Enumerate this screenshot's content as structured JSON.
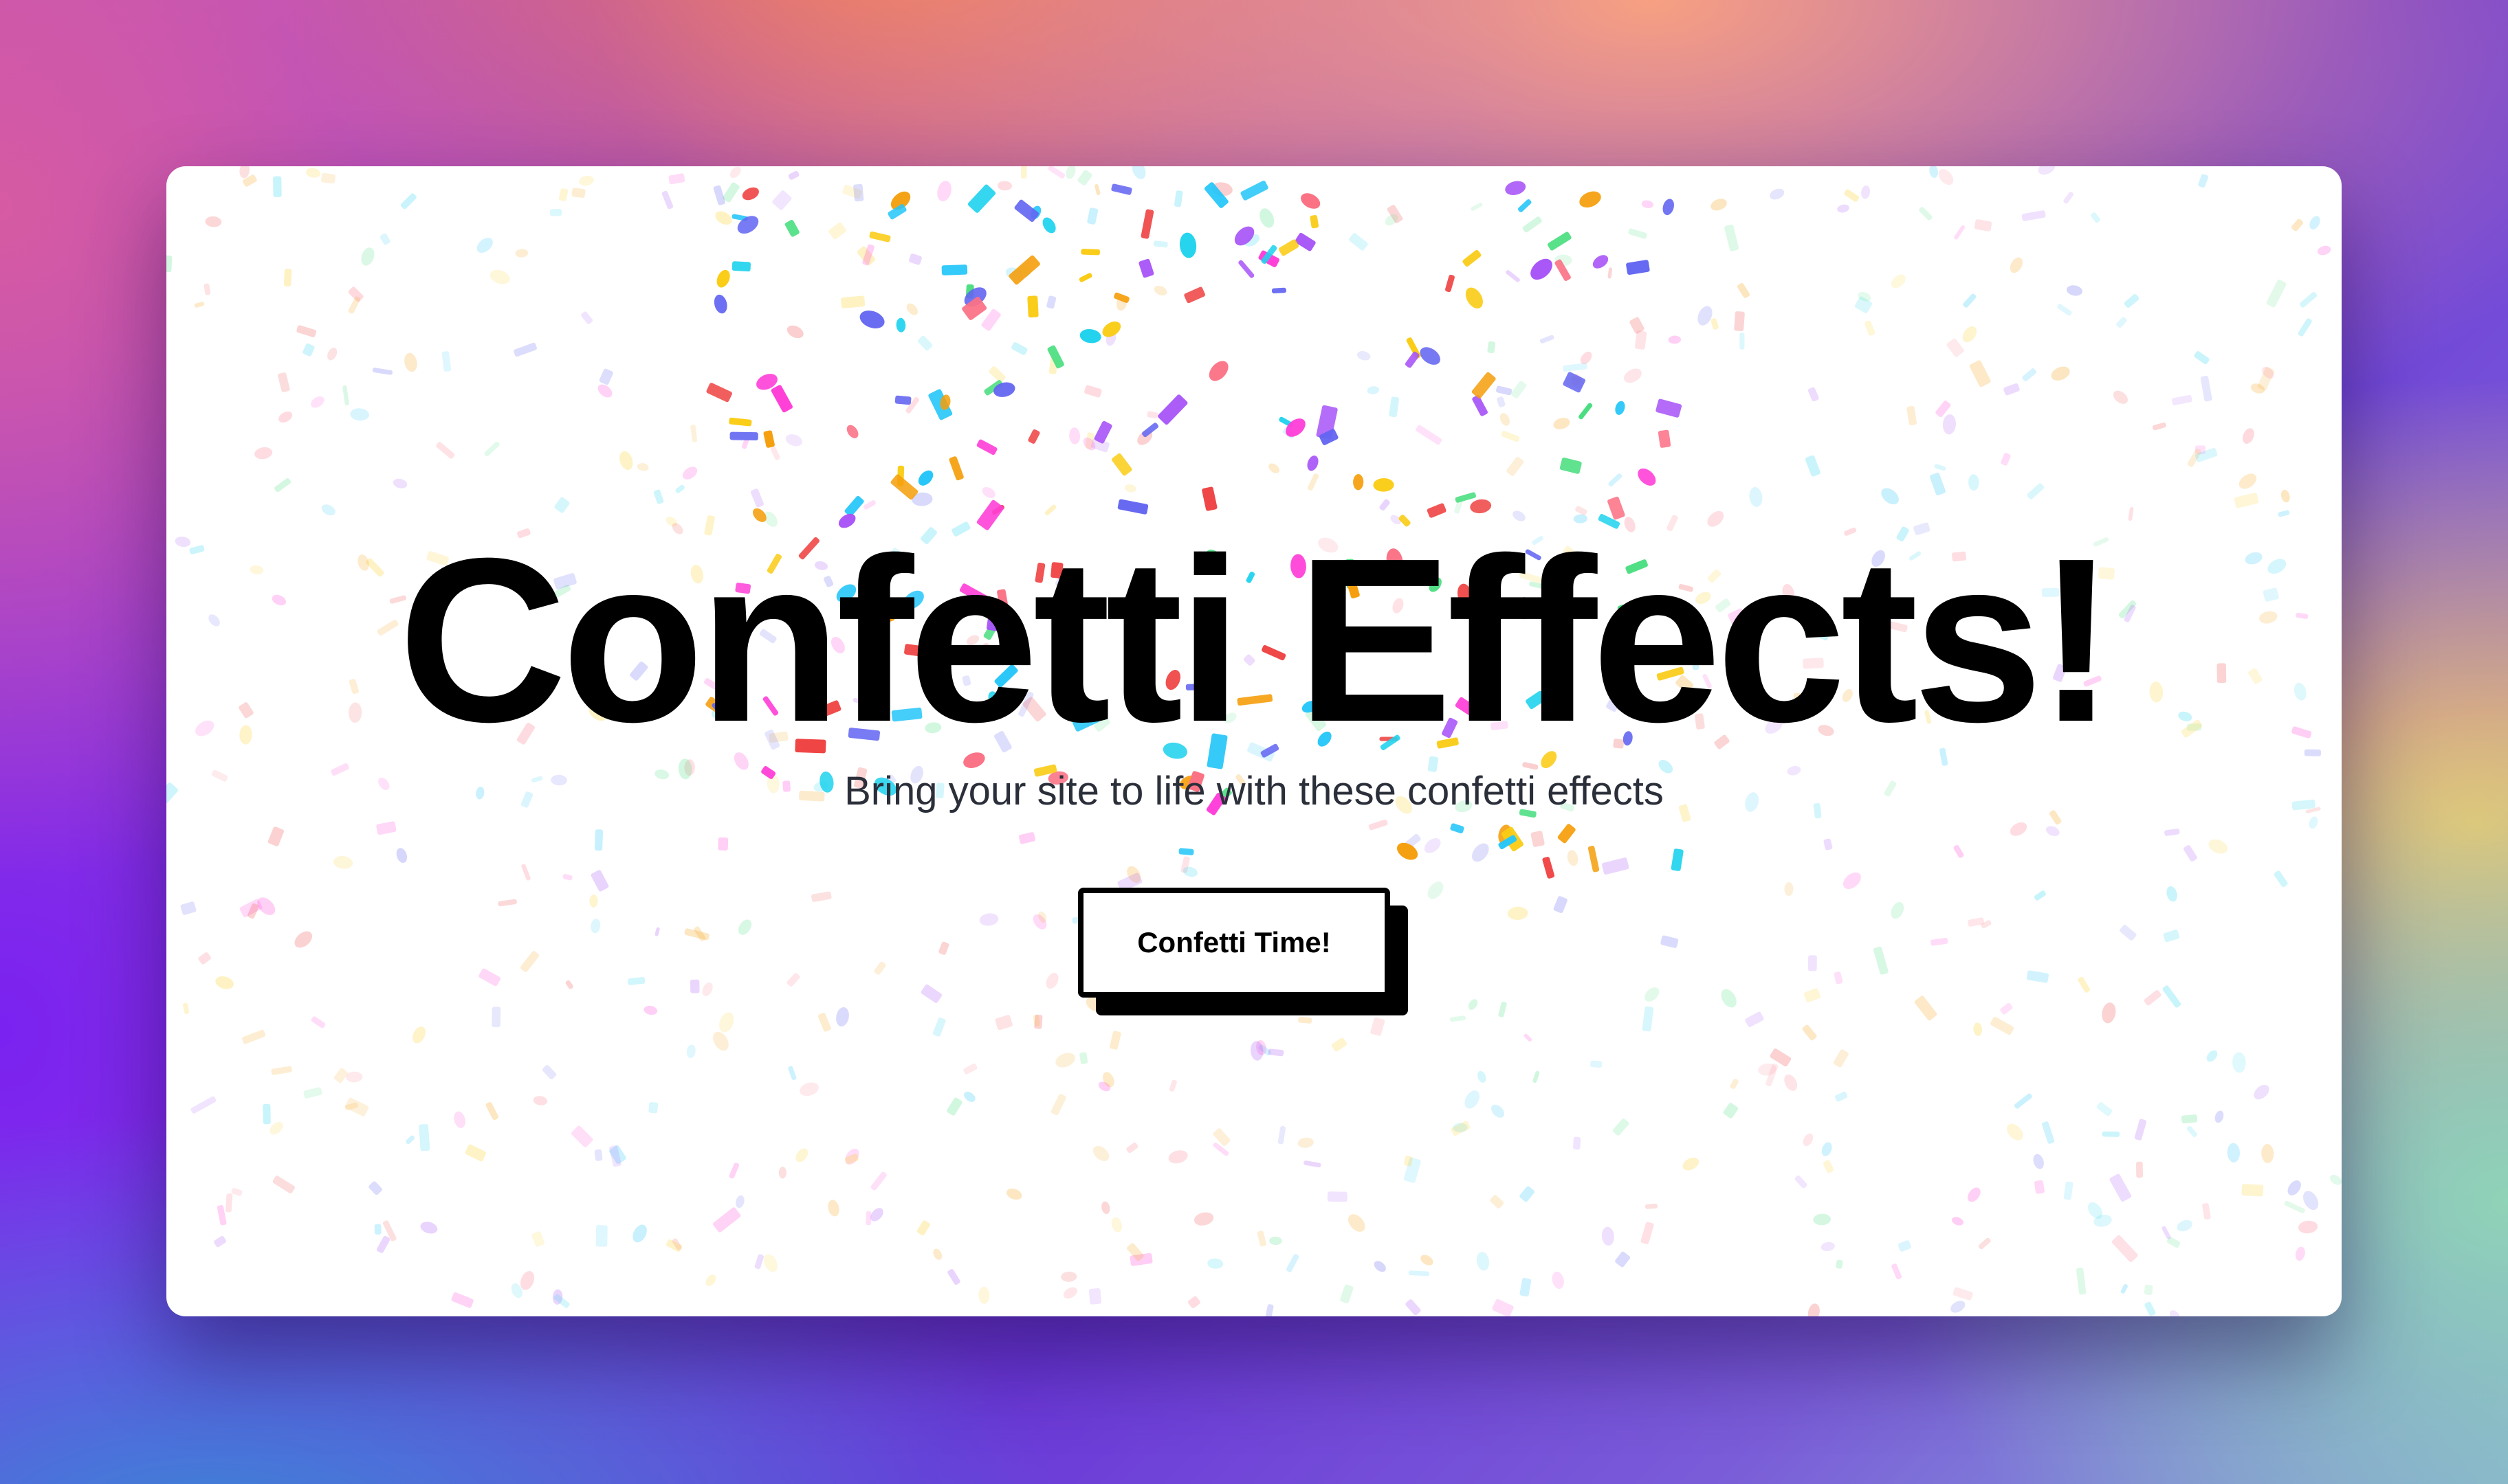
{
  "hero": {
    "title": "Confetti Effects!",
    "subtitle": "Bring your site to life with these confetti effects"
  },
  "cta": {
    "label": "Confetti Time!"
  },
  "colors": {
    "title": "#000000",
    "subtitle": "#2b2f3a",
    "button_border": "#000000",
    "button_fill": "#ffffff",
    "confetti_palette": [
      "#ff3fd8",
      "#a855f7",
      "#26c6f9",
      "#f59e0b",
      "#facc15",
      "#4ade80",
      "#ef4444",
      "#6366f1",
      "#fb7185",
      "#22d3ee"
    ]
  }
}
